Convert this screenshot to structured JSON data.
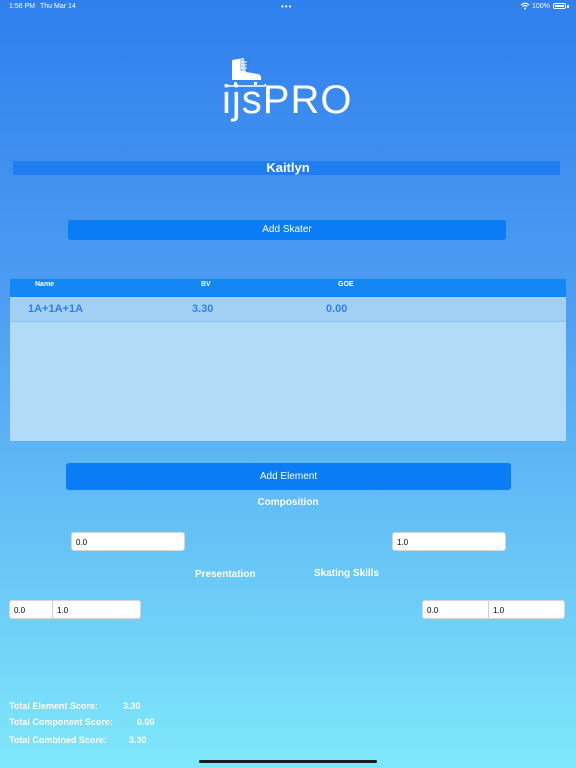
{
  "status_bar": {
    "time": "1:56 PM",
    "date": "Thu Mar 14",
    "battery": "100%"
  },
  "logo": {
    "text": "ijsPRO"
  },
  "skater": {
    "name": "Kaitlyn"
  },
  "buttons": {
    "add_skater": "Add Skater",
    "add_element": "Add Element"
  },
  "table": {
    "headers": [
      "Name",
      "BV",
      "GOE"
    ],
    "rows": [
      {
        "name": "1A+1A+1A",
        "bv": "3.30",
        "goe": "0.00"
      }
    ]
  },
  "composition": {
    "label": "Composition",
    "left_value": "0.0",
    "right_value": "1.0"
  },
  "presentation": {
    "label": "Presentation",
    "value": "0.0",
    "factor": "1.0"
  },
  "skating_skills": {
    "label": "Skating Skills",
    "value": "0.0",
    "factor": "1.0"
  },
  "totals": {
    "element_label": "Total Element Score:",
    "element_value": "3.30",
    "component_label": "Total Component Score:",
    "component_value": "0.00",
    "combined_label": "Total Combined Score:",
    "combined_value": "3.30"
  },
  "colors": {
    "button": "#0a7cf6",
    "table_header": "#1387f4",
    "table_body": "#b2dbf8",
    "row_text": "#2f7fe6"
  }
}
